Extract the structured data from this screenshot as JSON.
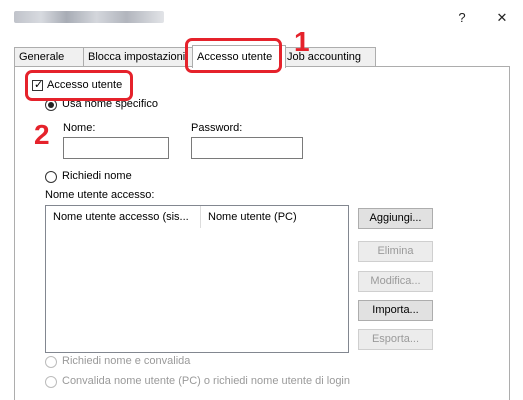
{
  "window": {
    "help_glyph": "?",
    "close_glyph": "✕"
  },
  "tabs": [
    {
      "label": "Generale"
    },
    {
      "label": "Blocca impostazioni"
    },
    {
      "label": "Accesso utente"
    },
    {
      "label": "Job accounting"
    }
  ],
  "callouts": {
    "step1": "1",
    "step2": "2",
    "color": "#e5222b"
  },
  "panel": {
    "checkbox_label": "Accesso utente",
    "checkbox_checked": true,
    "radio_specific_label": "Usa nome specifico",
    "name_label": "Nome:",
    "name_value": "",
    "password_label": "Password:",
    "password_value": "",
    "radio_prompt_label": "Richiedi nome",
    "list_label": "Nome utente accesso:",
    "columns": [
      "Nome utente accesso (sis...",
      "Nome utente (PC)"
    ],
    "buttons": {
      "add": "Aggiungi...",
      "delete": "Elimina",
      "edit": "Modifica...",
      "import": "Importa...",
      "export": "Esporta..."
    },
    "radio_validate_label": "Richiedi nome e convalida",
    "radio_pc_label": "Convalida nome utente (PC) o richiedi nome utente di login"
  }
}
